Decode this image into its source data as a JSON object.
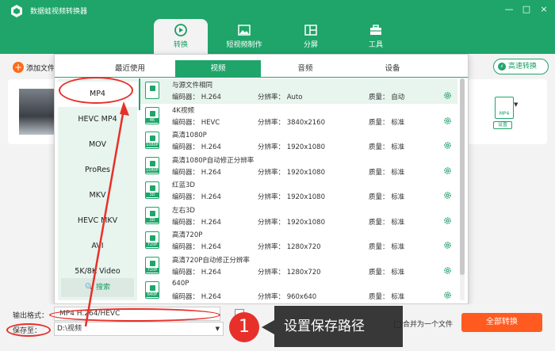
{
  "app": {
    "title": "数据蛙视频转换器"
  },
  "window_controls": [
    "—",
    "□",
    "×"
  ],
  "nav_tabs": [
    {
      "label": "转换",
      "icon": "convert-icon"
    },
    {
      "label": "短视频制作",
      "icon": "image-icon"
    },
    {
      "label": "分屏",
      "icon": "split-icon"
    },
    {
      "label": "工具",
      "icon": "toolbox-icon"
    }
  ],
  "toolbar": {
    "add_file": "添加文件",
    "fast_convert": "高速转换"
  },
  "file_item": {
    "format_badge": "MP4",
    "settings_label": "设置"
  },
  "format_panel": {
    "categories": [
      "最近使用",
      "视频",
      "音频",
      "设备"
    ],
    "active_category": 1,
    "formats": [
      "MP4",
      "HEVC MP4",
      "MOV",
      "ProRes",
      "MKV",
      "HEVC MKV",
      "AVI",
      "5K/8K Video"
    ],
    "search_label": "搜索",
    "presets": [
      {
        "name": "与源文件相同",
        "icon_text": "",
        "codec": "编码器： H.264",
        "resolution": "分辨率： Auto",
        "quality": "质量： 自动"
      },
      {
        "name": "4K视频",
        "icon_text": "4K",
        "codec": "编码器： HEVC",
        "resolution": "分辨率： 3840x2160",
        "quality": "质量： 标准"
      },
      {
        "name": "高清1080P",
        "icon_text": "1080P",
        "codec": "编码器： H.264",
        "resolution": "分辨率： 1920x1080",
        "quality": "质量： 标准"
      },
      {
        "name": "高清1080P自动修正分辨率",
        "icon_text": "1080P",
        "codec": "编码器： H.264",
        "resolution": "分辨率： 1920x1080",
        "quality": "质量： 标准"
      },
      {
        "name": "红蓝3D",
        "icon_text": "3D",
        "codec": "编码器： H.264",
        "resolution": "分辨率： 1920x1080",
        "quality": "质量： 标准"
      },
      {
        "name": "左右3D",
        "icon_text": "3D",
        "codec": "编码器： H.264",
        "resolution": "分辨率： 1920x1080",
        "quality": "质量： 标准"
      },
      {
        "name": "高清720P",
        "icon_text": "720P",
        "codec": "编码器： H.264",
        "resolution": "分辨率： 1280x720",
        "quality": "质量： 标准"
      },
      {
        "name": "高清720P自动修正分辨率",
        "icon_text": "720P",
        "codec": "编码器： H.264",
        "resolution": "分辨率： 1280x720",
        "quality": "质量： 标准"
      },
      {
        "name": "640P",
        "icon_text": "640P",
        "codec": "编码器： H.264",
        "resolution": "分辨率： 960x640",
        "quality": "质量： 标准"
      }
    ]
  },
  "bottom_bar": {
    "output_format_label": "输出格式：",
    "output_format_value": "MP4 H.264/HEVC",
    "save_to_label": "保存至：",
    "save_to_value": "D:\\视频",
    "merge_label": "合并为一个文件",
    "convert_all": "全部转换"
  },
  "annotation": {
    "number": "1",
    "text": "设置保存路径"
  },
  "colors": {
    "brand_green": "#1fa56a",
    "accent_orange": "#ff5a1f",
    "annotation_red": "#e8302a"
  }
}
